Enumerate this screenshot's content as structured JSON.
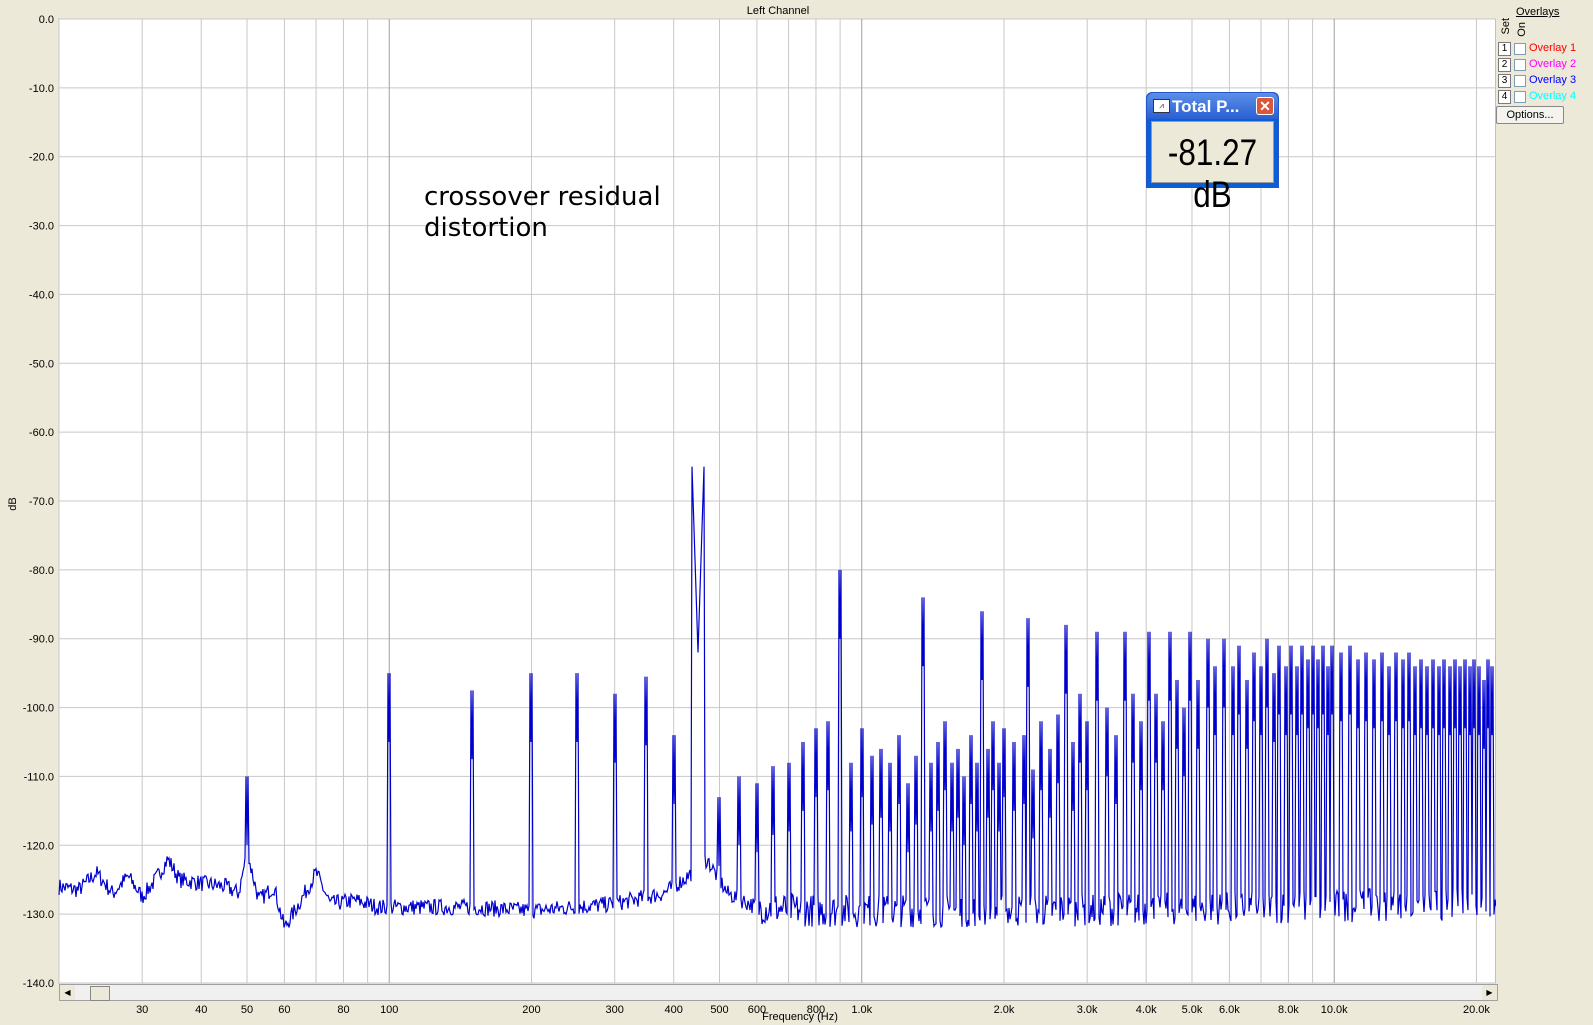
{
  "chart_data": {
    "type": "line",
    "title": "Left Channel",
    "xlabel": "Frequency (Hz)",
    "ylabel": "dB",
    "xscale": "log",
    "xlim": [
      20,
      22000
    ],
    "ylim": [
      -140,
      0
    ],
    "grid": true,
    "yticks": [
      0,
      -10,
      -20,
      -30,
      -40,
      -50,
      -60,
      -70,
      -80,
      -90,
      -100,
      -110,
      -120,
      -130,
      -140
    ],
    "ytick_labels": [
      "0.0",
      "-10.0",
      "-20.0",
      "-30.0",
      "-40.0",
      "-50.0",
      "-60.0",
      "-70.0",
      "-80.0",
      "-90.0",
      "-100.0",
      "-110.0",
      "-120.0",
      "-130.0",
      "-140.0"
    ],
    "xticks": [
      30,
      40,
      50,
      60,
      80,
      100,
      200,
      300,
      400,
      500,
      600,
      800,
      1000,
      2000,
      3000,
      4000,
      5000,
      6000,
      8000,
      10000,
      20000
    ],
    "xtick_labels": [
      "30",
      "40",
      "50",
      "60",
      "80",
      "100",
      "200",
      "300",
      "400",
      "500",
      "600",
      "800",
      "1.0k",
      "2.0k",
      "3.0k",
      "4.0k",
      "5.0k",
      "6.0k",
      "8.0k",
      "10.0k",
      "20.0k"
    ],
    "annotation": [
      "crossover residual",
      "distortion"
    ],
    "line_color": "#0000cc",
    "series": [
      {
        "noise_floor": [
          [
            20,
            -126
          ],
          [
            22,
            -126.5
          ],
          [
            24,
            -124
          ],
          [
            26,
            -127
          ],
          [
            28,
            -124.5
          ],
          [
            30,
            -127.5
          ],
          [
            32,
            -125
          ],
          [
            34,
            -122
          ],
          [
            36,
            -125
          ],
          [
            40,
            -125.5
          ],
          [
            45,
            -126
          ],
          [
            48,
            -127
          ],
          [
            50,
            -121
          ],
          [
            53,
            -128
          ],
          [
            57,
            -126
          ],
          [
            60,
            -132
          ],
          [
            65,
            -128
          ],
          [
            70,
            -124
          ],
          [
            75,
            -128.5
          ],
          [
            85,
            -128
          ],
          [
            95,
            -129
          ],
          [
            110,
            -129
          ],
          [
            150,
            -129
          ],
          [
            200,
            -129.5
          ],
          [
            300,
            -128.5
          ],
          [
            380,
            -127
          ],
          [
            420,
            -125
          ],
          [
            470,
            -122
          ],
          [
            520,
            -127
          ],
          [
            600,
            -129
          ],
          [
            800,
            -129.5
          ],
          [
            1000,
            -129.5
          ],
          [
            2000,
            -129.5
          ],
          [
            5000,
            -129.2
          ],
          [
            10000,
            -128.8
          ],
          [
            20000,
            -128.5
          ],
          [
            22000,
            -128.5
          ]
        ],
        "peaks": [
          [
            50,
            -120
          ],
          [
            100,
            -105
          ],
          [
            150,
            -107.5
          ],
          [
            200,
            -105
          ],
          [
            250,
            -105
          ],
          [
            300,
            -108
          ],
          [
            350,
            -105.5
          ],
          [
            400,
            -114
          ],
          [
            450,
            -92
          ],
          [
            500,
            -123
          ],
          [
            550,
            -120
          ],
          [
            600,
            -121
          ],
          [
            650,
            -118.5
          ],
          [
            700,
            -118
          ],
          [
            750,
            -115
          ],
          [
            800,
            -113
          ],
          [
            850,
            -112
          ],
          [
            900,
            -90
          ],
          [
            950,
            -118
          ],
          [
            1000,
            -113
          ],
          [
            1050,
            -117
          ],
          [
            1100,
            -116
          ],
          [
            1150,
            -118
          ],
          [
            1200,
            -114
          ],
          [
            1250,
            -121
          ],
          [
            1300,
            -117
          ],
          [
            1350,
            -94
          ],
          [
            1400,
            -118
          ],
          [
            1450,
            -115
          ],
          [
            1500,
            -112
          ],
          [
            1550,
            -118
          ],
          [
            1600,
            -116
          ],
          [
            1650,
            -120
          ],
          [
            1700,
            -114
          ],
          [
            1750,
            -118
          ],
          [
            1800,
            -96
          ],
          [
            1850,
            -116
          ],
          [
            1900,
            -112
          ],
          [
            1950,
            -118
          ],
          [
            2000,
            -113
          ],
          [
            2100,
            -115
          ],
          [
            2200,
            -114
          ],
          [
            2250,
            -97
          ],
          [
            2300,
            -119
          ],
          [
            2400,
            -112
          ],
          [
            2500,
            -116
          ],
          [
            2600,
            -111
          ],
          [
            2700,
            -98
          ],
          [
            2800,
            -115
          ],
          [
            2900,
            -108
          ],
          [
            3000,
            -112
          ],
          [
            3150,
            -99
          ],
          [
            3300,
            -110
          ],
          [
            3450,
            -114
          ],
          [
            3600,
            -99
          ],
          [
            3750,
            -108
          ],
          [
            3900,
            -112
          ],
          [
            4050,
            -99
          ],
          [
            4200,
            -108
          ],
          [
            4350,
            -112
          ],
          [
            4500,
            -99
          ],
          [
            4650,
            -106
          ],
          [
            4800,
            -110
          ],
          [
            4950,
            -99
          ],
          [
            5150,
            -106
          ],
          [
            5400,
            -100
          ],
          [
            5600,
            -104
          ],
          [
            5850,
            -100
          ],
          [
            6100,
            -104
          ],
          [
            6300,
            -101
          ],
          [
            6550,
            -106
          ],
          [
            6750,
            -102
          ],
          [
            7000,
            -104
          ],
          [
            7200,
            -100
          ],
          [
            7450,
            -105
          ],
          [
            7650,
            -101
          ],
          [
            7900,
            -104
          ],
          [
            8100,
            -101
          ],
          [
            8350,
            -104
          ],
          [
            8550,
            -101
          ],
          [
            8800,
            -103
          ],
          [
            9000,
            -101
          ],
          [
            9250,
            -103
          ],
          [
            9450,
            -101
          ],
          [
            9700,
            -104
          ],
          [
            9900,
            -101
          ],
          [
            10350,
            -102
          ],
          [
            10800,
            -101
          ],
          [
            11250,
            -103
          ],
          [
            11700,
            -102
          ],
          [
            12150,
            -103
          ],
          [
            12600,
            -102
          ],
          [
            13050,
            -104
          ],
          [
            13500,
            -102
          ],
          [
            13950,
            -103
          ],
          [
            14400,
            -102
          ],
          [
            14850,
            -104
          ],
          [
            15300,
            -103
          ],
          [
            15750,
            -104
          ],
          [
            16200,
            -103
          ],
          [
            16650,
            -104
          ],
          [
            17100,
            -103
          ],
          [
            17550,
            -104
          ],
          [
            18000,
            -103
          ],
          [
            18450,
            -104
          ],
          [
            18900,
            -103
          ],
          [
            19350,
            -104
          ],
          [
            19800,
            -103
          ],
          [
            20250,
            -104
          ],
          [
            20700,
            -106
          ],
          [
            21150,
            -103
          ],
          [
            21600,
            -104
          ]
        ]
      }
    ]
  },
  "overlays": {
    "title": "Overlays",
    "set_label": "Set",
    "on_label": "On",
    "items": [
      {
        "num": "1",
        "name": "Overlay 1",
        "color": "#ff0000"
      },
      {
        "num": "2",
        "name": "Overlay 2",
        "color": "#ff00ff"
      },
      {
        "num": "3",
        "name": "Overlay 3",
        "color": "#0000ff"
      },
      {
        "num": "4",
        "name": "Overlay 4",
        "color": "#00ffff"
      }
    ],
    "options_label": "Options..."
  },
  "readout": {
    "title": "Total P...",
    "value": "-81.27 dB",
    "icon": "meter-icon",
    "close_icon": "close-icon"
  },
  "scrollbar": {
    "left_icon": "arrow-left-icon",
    "right_icon": "arrow-right-icon"
  }
}
